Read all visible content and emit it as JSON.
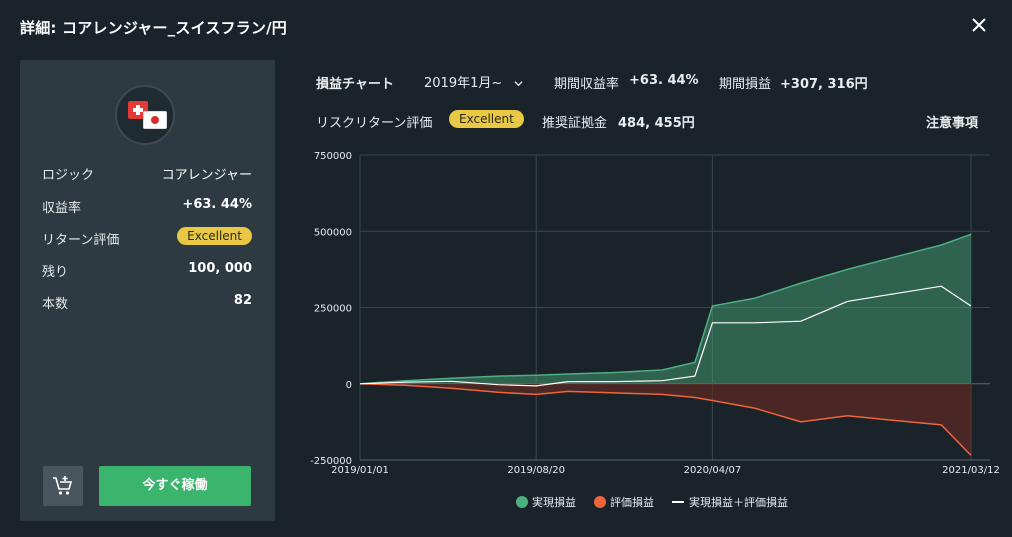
{
  "modal": {
    "title": "詳細: コアレンジャー_スイスフラン/円"
  },
  "strategy": {
    "logic_label": "ロジック",
    "logic_value": "コアレンジャー",
    "return_rate_label": "収益率",
    "return_rate_value": "+63. 44%",
    "return_rating_label": "リターン評価",
    "return_rating_value": "Excellent",
    "remaining_label": "残り",
    "remaining_value": "100, 000",
    "count_label": "本数",
    "count_value": "82",
    "run_button": "今すぐ稼働"
  },
  "chart_header": {
    "title": "損益チャート",
    "period": "2019年1月~",
    "period_return_label": "期間収益率",
    "period_return_value": "+63. 44%",
    "period_pnl_label": "期間損益",
    "period_pnl_value": "+307, 316円",
    "risk_return_label": "リスクリターン評価",
    "risk_return_value": "Excellent",
    "margin_label": "推奨証拠金",
    "margin_value": "484, 455円",
    "notes_link": "注意事項"
  },
  "legend": {
    "realized": "実現損益",
    "unrealized": "評価損益",
    "total": "実現損益＋評価損益"
  },
  "colors": {
    "realized": "#4cb07f",
    "unrealized": "#f0643a",
    "total": "#ffffff",
    "badge": "#e8c845",
    "button": "#3bb56e"
  },
  "chart_data": {
    "type": "area",
    "x_tick_labels": [
      "2019/01/01",
      "2019/08/20",
      "2020/04/07",
      "2021/03/12"
    ],
    "y_tick_labels": [
      "750000",
      "500000",
      "250000",
      "0",
      "-250000"
    ],
    "ylim": [
      -250000,
      750000
    ],
    "x": [
      "2019/01/01",
      "2019/03/01",
      "2019/05/01",
      "2019/07/01",
      "2019/08/20",
      "2019/10/01",
      "2019/12/01",
      "2020/02/01",
      "2020/03/15",
      "2020/04/07",
      "2020/06/01",
      "2020/08/01",
      "2020/10/01",
      "2020/12/01",
      "2021/02/01",
      "2021/03/12"
    ],
    "series": [
      {
        "name": "実現損益",
        "values": [
          0,
          10000,
          18000,
          25000,
          28000,
          32000,
          37000,
          45000,
          70000,
          255000,
          280000,
          330000,
          375000,
          415000,
          455000,
          490000
        ]
      },
      {
        "name": "評価損益",
        "values": [
          0,
          -5000,
          -15000,
          -28000,
          -35000,
          -25000,
          -30000,
          -35000,
          -45000,
          -55000,
          -80000,
          -125000,
          -105000,
          -120000,
          -135000,
          -235000
        ]
      },
      {
        "name": "実現損益＋評価損益",
        "values": [
          0,
          5000,
          8000,
          -3000,
          -7000,
          7000,
          7000,
          10000,
          25000,
          200000,
          200000,
          205000,
          270000,
          295000,
          320000,
          255000
        ]
      }
    ]
  }
}
